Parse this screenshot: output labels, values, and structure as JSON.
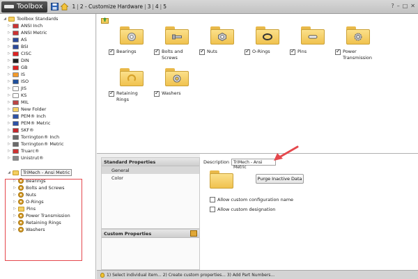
{
  "titlebar": {
    "app_name": "Toolbox",
    "crumbs": [
      "1",
      "2 - Customize Hardware",
      "3",
      "4",
      "5"
    ],
    "controls": [
      "?",
      "–",
      "□",
      "✕"
    ]
  },
  "tree": {
    "root": "Toolbox Standards",
    "standards": [
      {
        "label": "ANSI Inch",
        "icon": "us-flag-icon",
        "color": "#c33"
      },
      {
        "label": "ANSI Metric",
        "icon": "us-flag-icon",
        "color": "#c33"
      },
      {
        "label": "AS",
        "icon": "australia-flag-icon",
        "color": "#2c4a9a"
      },
      {
        "label": "BSI",
        "icon": "uk-flag-icon",
        "color": "#2c4a9a"
      },
      {
        "label": "CISC",
        "icon": "canada-flag-icon",
        "color": "#d22"
      },
      {
        "label": "DIN",
        "icon": "germany-flag-icon",
        "color": "#222"
      },
      {
        "label": "GB",
        "icon": "china-flag-icon",
        "color": "#d22"
      },
      {
        "label": "IS",
        "icon": "india-flag-icon",
        "color": "#f39a2a"
      },
      {
        "label": "ISO",
        "icon": "iso-icon",
        "color": "#1f4f9c"
      },
      {
        "label": "JIS",
        "icon": "japan-flag-icon",
        "color": "#ffffff"
      },
      {
        "label": "KS",
        "icon": "korea-flag-icon",
        "color": "#ffffff"
      },
      {
        "label": "MIL",
        "icon": "mil-icon",
        "color": "#b44"
      },
      {
        "label": "New Folder",
        "icon": "folder-icon",
        "color": "#f4cf62"
      },
      {
        "label": "PEM® Inch",
        "icon": "pem-icon",
        "color": "#2d52a6"
      },
      {
        "label": "PEM® Metric",
        "icon": "pem-icon",
        "color": "#2d52a6"
      },
      {
        "label": "SKF®",
        "icon": "skf-icon",
        "color": "#c4272d"
      },
      {
        "label": "Torrington® Inch",
        "icon": "torrington-icon",
        "color": "#6a6a6a"
      },
      {
        "label": "Torrington® Metric",
        "icon": "torrington-icon",
        "color": "#6a6a6a"
      },
      {
        "label": "Truarc®",
        "icon": "truarc-icon",
        "color": "#c33"
      },
      {
        "label": "Unistrut®",
        "icon": "unistrut-icon",
        "color": "#888"
      }
    ],
    "custom_standard": "TriMech - Ansi Metric",
    "custom_children": [
      "Bearings",
      "Bolts and Screws",
      "Nuts",
      "O-Rings",
      "Pins",
      "Power Transmission",
      "Retaining Rings",
      "Washers"
    ]
  },
  "tiles": [
    {
      "label": "Bearings",
      "icon": "bearing-icon",
      "checked": true
    },
    {
      "label": "Bolts and Screws",
      "icon": "bolt-icon",
      "checked": true
    },
    {
      "label": "Nuts",
      "icon": "nut-icon",
      "checked": true
    },
    {
      "label": "O-Rings",
      "icon": "o-ring-icon",
      "checked": true
    },
    {
      "label": "Pins",
      "icon": "pin-icon",
      "checked": true
    },
    {
      "label": "Power Transmission",
      "icon": "gear-icon",
      "checked": true
    },
    {
      "label": "Retaining Rings",
      "icon": "retaining-ring-icon",
      "checked": true
    },
    {
      "label": "Washers",
      "icon": "washer-icon",
      "checked": true
    }
  ],
  "standard_properties": {
    "title": "Standard Properties",
    "items": [
      "General",
      "Color"
    ],
    "selected": "General"
  },
  "custom_properties": {
    "title": "Custom Properties"
  },
  "detail": {
    "description_label": "Description",
    "description_value": "TriMech - Ansi Metric",
    "purge_button": "Purge Inactive Data",
    "options": [
      {
        "label": "Allow custom configuration name",
        "checked": false
      },
      {
        "label": "Allow custom designation",
        "checked": false
      }
    ]
  },
  "status_bar": "1) Select individual item... 2) Create custom properties... 3) Add Part Numbers...",
  "colors": {
    "accent_red": "#e5484d",
    "folder": "#f4cf62",
    "titlebar": "#c8c8c8"
  }
}
